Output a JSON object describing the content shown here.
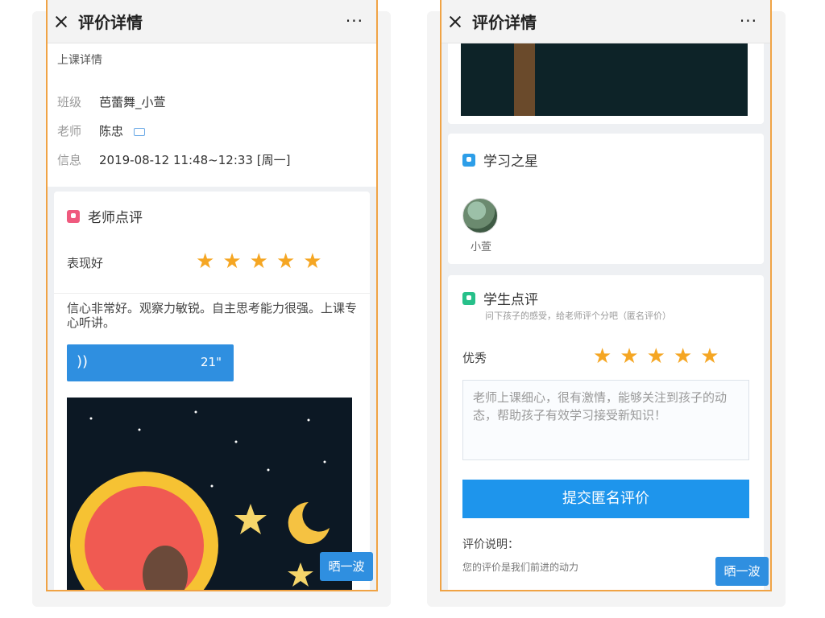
{
  "left_screen": {
    "header": {
      "title": "评价详情",
      "more_label": "···"
    },
    "class_info": {
      "section_label": "上课详情",
      "rows": [
        {
          "key": "班级",
          "value": "芭蕾舞_小萱"
        },
        {
          "key": "老师",
          "value": "陈忠"
        },
        {
          "key": "信息",
          "value": "2019-08-12 11:48~12:33 [周一]"
        }
      ]
    },
    "teacher_review": {
      "title": "老师点评",
      "rating_label": "表现好",
      "rating": 5,
      "comment": "信心非常好。观察力敏锐。自主思考能力很强。上课专心听讲。",
      "voice_duration": "21\""
    },
    "float_button": "晒一波"
  },
  "right_screen": {
    "header": {
      "title": "评价详情",
      "more_label": "···"
    },
    "star_section": {
      "title": "学习之星",
      "student_name": "小萱"
    },
    "student_review": {
      "title": "学生点评",
      "subtitle": "问下孩子的感受，给老师评个分吧（匿名评价）",
      "rating_label": "优秀",
      "rating": 5,
      "comment": "老师上课细心，很有激情，能够关注到孩子的动态，帮助孩子有效学习接受新知识！",
      "submit_label": "提交匿名评价",
      "note_title": "评价说明：",
      "note_text": "您的评价是我们前进的动力"
    },
    "float_button": "晒一波"
  },
  "colors": {
    "accent": "#2f8fe0",
    "star": "#f5a623",
    "frame": "#f0a345"
  },
  "icons": [
    "close-icon",
    "more-icon",
    "teacher-review-icon",
    "voice-icon",
    "star-icon",
    "study-star-icon",
    "student-review-icon"
  ]
}
